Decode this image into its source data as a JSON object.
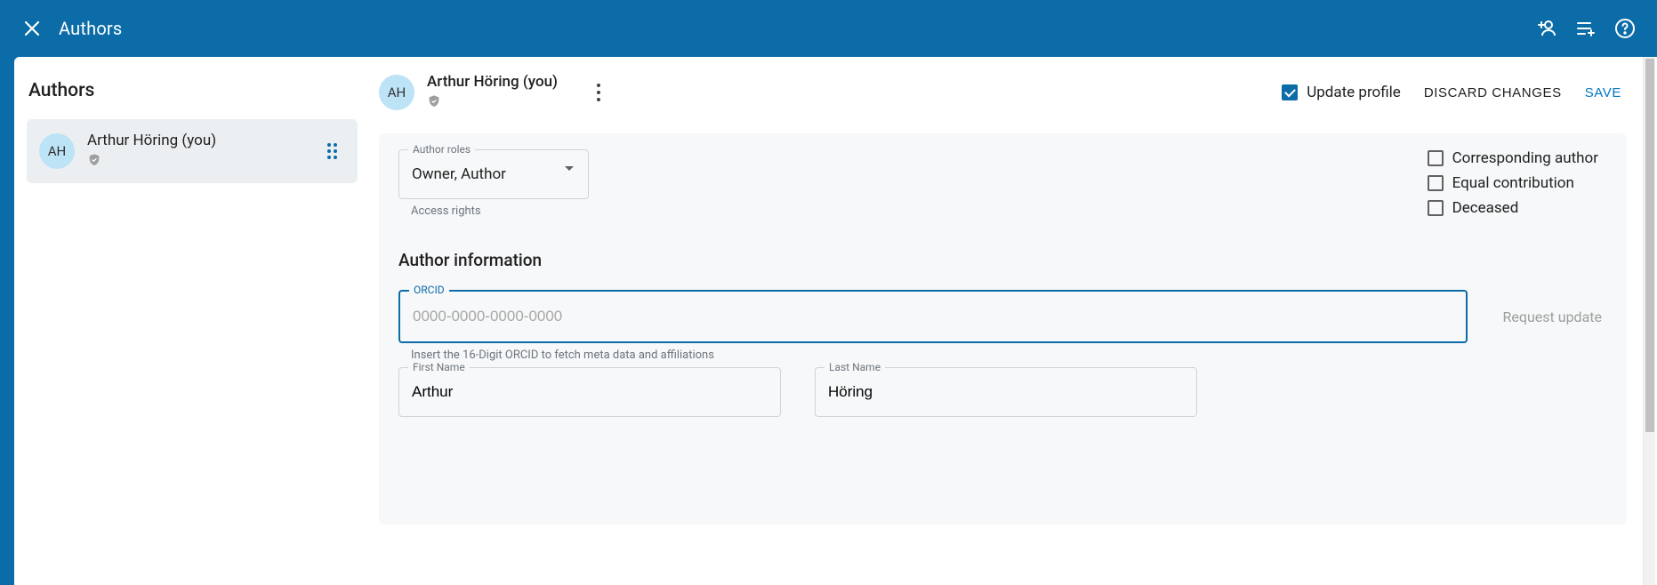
{
  "topbar": {
    "title": "Authors"
  },
  "sidebar": {
    "title": "Authors",
    "items": [
      {
        "initials": "AH",
        "name": "Arthur Höring (you)"
      }
    ]
  },
  "header": {
    "avatar_initials": "AH",
    "name": "Arthur Höring (you)",
    "update_profile_label": "Update profile",
    "discard_label": "Discard changes",
    "save_label": "Save"
  },
  "form": {
    "roles": {
      "label": "Author roles",
      "value": "Owner, Author",
      "helper": "Access rights"
    },
    "flags": {
      "corresponding_label": "Corresponding author",
      "equal_label": "Equal contribution",
      "deceased_label": "Deceased"
    },
    "section_title": "Author information",
    "orcid": {
      "label": "ORCID",
      "placeholder": "0000-0000-0000-0000",
      "value": "",
      "helper": "Insert the 16-Digit ORCID to fetch meta data and affiliations",
      "request_label": "Request update"
    },
    "first_name": {
      "label": "First Name",
      "value": "Arthur"
    },
    "last_name": {
      "label": "Last Name",
      "value": "Höring"
    }
  }
}
